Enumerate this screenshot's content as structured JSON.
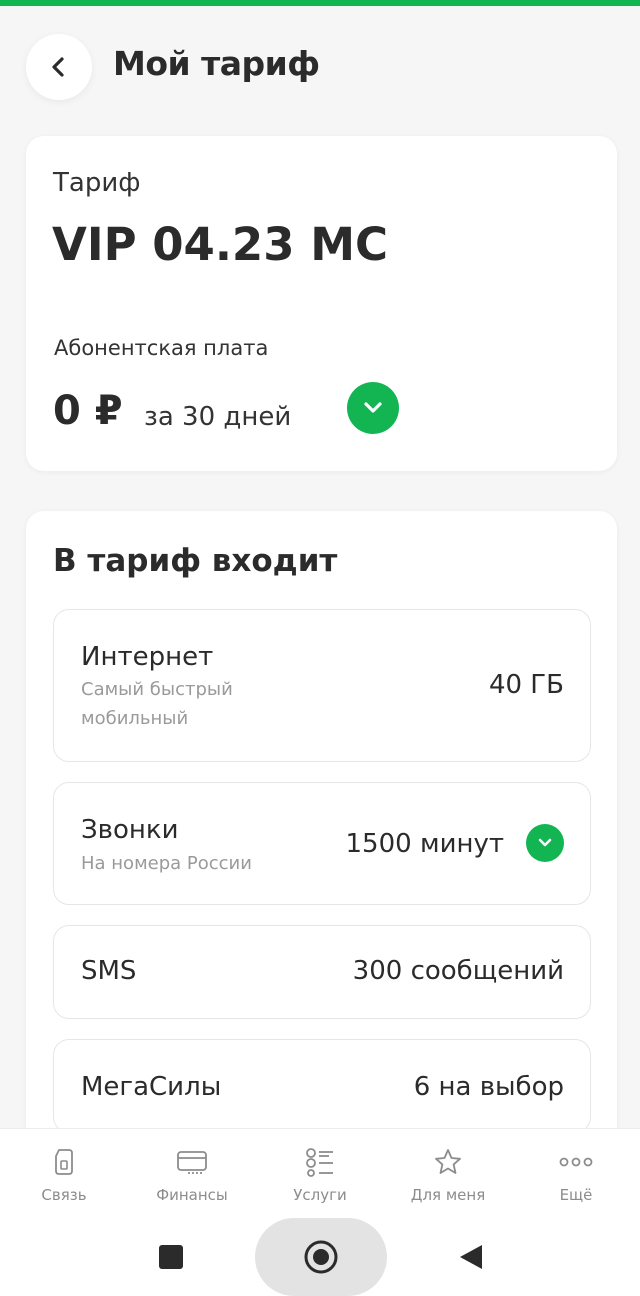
{
  "header": {
    "title": "Мой тариф",
    "back_icon": "chevron-left-icon"
  },
  "tariff": {
    "label": "Тариф",
    "name": "VIP 04.23 MC",
    "fee_label": "Абонентская плата",
    "fee_amount": "0 ₽",
    "fee_period": "за 30 дней"
  },
  "included": {
    "title": "В тариф входит",
    "items": [
      {
        "name": "Интернет",
        "subtitle": "Самый быстрый мобильный",
        "value": "40 ГБ"
      },
      {
        "name": "Звонки",
        "subtitle": "На номера России",
        "value": "1500 минут"
      },
      {
        "name": "SMS",
        "subtitle": "",
        "value": "300 сообщений"
      },
      {
        "name": "МегаСилы",
        "subtitle": "",
        "value": "6 на выбор"
      }
    ]
  },
  "nav": {
    "items": [
      {
        "label": "Связь",
        "icon": "sim-card-icon"
      },
      {
        "label": "Финансы",
        "icon": "wallet-icon"
      },
      {
        "label": "Услуги",
        "icon": "list-icon"
      },
      {
        "label": "Для меня",
        "icon": "star-icon"
      },
      {
        "label": "Ещё",
        "icon": "more-dots-icon"
      }
    ]
  },
  "colors": {
    "accent": "#12b552",
    "background": "#f6f6f6",
    "text": "#2b2b2b",
    "muted": "#9a9a9a"
  }
}
